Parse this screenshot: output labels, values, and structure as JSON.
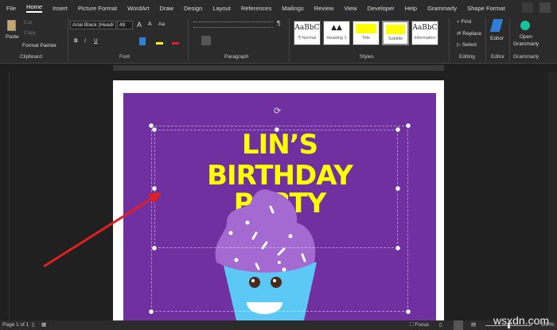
{
  "tabs": [
    "File",
    "Home",
    "Insert",
    "Picture Format",
    "WordArt",
    "Draw",
    "Design",
    "Layout",
    "References",
    "Mailings",
    "Review",
    "View",
    "Developer",
    "Help",
    "Grammarly",
    "Shape Format"
  ],
  "clipboard": {
    "paste": "Paste",
    "cut": "Cut",
    "copy": "Copy",
    "format_painter": "Format Painter",
    "label": "Clipboard"
  },
  "font": {
    "name": "Arial Black (Headi",
    "size": "48",
    "label": "Font",
    "bold": "B",
    "italic": "I",
    "underline": "U",
    "grow": "A",
    "shrink": "A",
    "case": "Aa"
  },
  "paragraph": {
    "label": "Paragraph",
    "pilcrow": "¶"
  },
  "styles": {
    "label": "Styles",
    "items": [
      {
        "preview": "AaBbC",
        "name": "¶ Normal"
      },
      {
        "preview": "▲▲",
        "name": "Heading 1"
      },
      {
        "preview": "",
        "name": "Title"
      },
      {
        "preview": "",
        "name": "Subtitle"
      },
      {
        "preview": "AaBbC",
        "name": "Information"
      }
    ]
  },
  "editing": {
    "find": "Find",
    "replace": "Replace",
    "select": "Select",
    "label": "Editing"
  },
  "editor": {
    "button": "Editor",
    "label": "Editor"
  },
  "grammarly": {
    "button_line1": "Open",
    "button_line2": "Grammarly",
    "label": "Grammarly"
  },
  "document": {
    "line1": "LIN’S",
    "line2": "BIRTHDAY",
    "line3": "PARTY"
  },
  "status": {
    "page": "Page 1 of 1",
    "focus": "Focus",
    "zoom": "100%"
  },
  "watermark": "wsxdn.com",
  "colors": {
    "purple": "#7030a0",
    "yellow": "#ffff00",
    "arrow": "#e02020"
  }
}
